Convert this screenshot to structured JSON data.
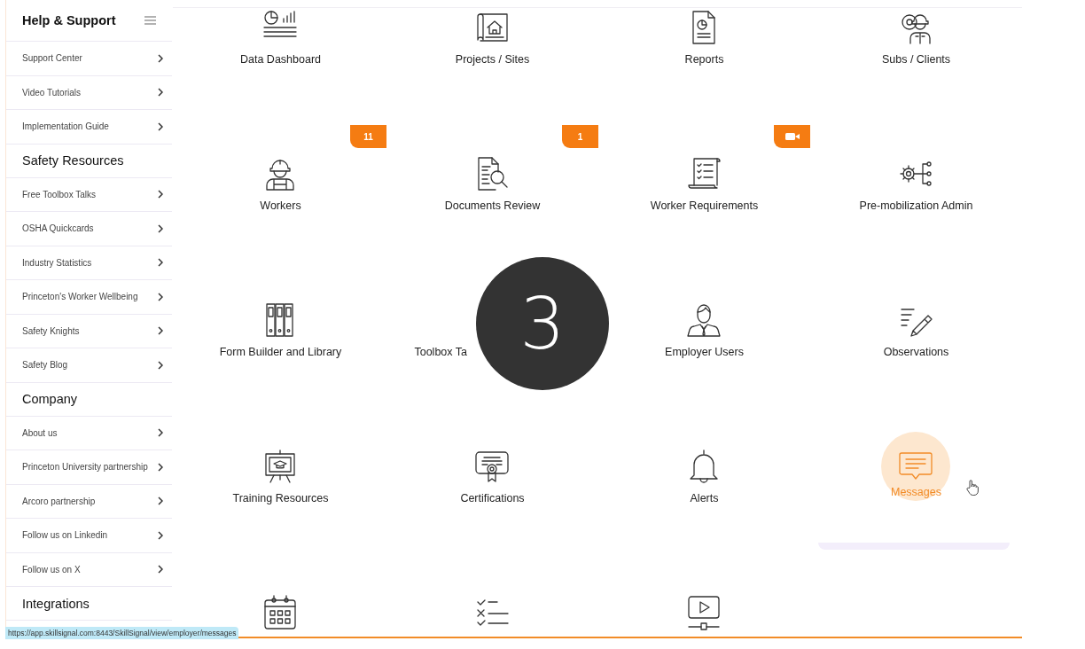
{
  "sidebar": {
    "sections": [
      {
        "title": "Help & Support",
        "menu_button": true,
        "items": [
          {
            "label": "Support Center"
          },
          {
            "label": "Video Tutorials"
          },
          {
            "label": "Implementation Guide"
          }
        ]
      },
      {
        "title": "Safety Resources",
        "menu_button": false,
        "items": [
          {
            "label": "Free Toolbox Talks"
          },
          {
            "label": "OSHA Quickcards"
          },
          {
            "label": "Industry Statistics"
          },
          {
            "label": "Princeton's Worker Wellbeing"
          },
          {
            "label": "Safety Knights"
          },
          {
            "label": "Safety Blog"
          }
        ]
      },
      {
        "title": "Company",
        "menu_button": false,
        "items": [
          {
            "label": "About us"
          },
          {
            "label": "Princeton University partnership"
          },
          {
            "label": "Arcoro partnership"
          },
          {
            "label": "Follow us on Linkedin"
          },
          {
            "label": "Follow us on X"
          }
        ]
      },
      {
        "title": "Integrations",
        "menu_button": false
      }
    ]
  },
  "tiles": [
    {
      "label": "Data Dashboard",
      "selected": false
    },
    {
      "label": "Projects / Sites",
      "selected": false
    },
    {
      "label": "Reports",
      "selected": false
    },
    {
      "label": "Subs / Clients",
      "selected": false
    },
    {
      "label": "Workers",
      "selected": false,
      "badge": {
        "kind": "count",
        "text": "11"
      }
    },
    {
      "label": "Documents Review",
      "selected": false,
      "badge": {
        "kind": "count",
        "text": "1"
      }
    },
    {
      "label": "Worker Requirements",
      "selected": false,
      "badge": {
        "kind": "video"
      }
    },
    {
      "label": "Pre-mobilization Admin",
      "selected": false
    },
    {
      "label": "Form Builder and Library",
      "selected": false
    },
    {
      "label": "Toolbox Ta",
      "selected": false,
      "covered": true
    },
    {
      "label": "Employer Users",
      "selected": false
    },
    {
      "label": "Observations",
      "selected": false
    },
    {
      "label": "Training Resources",
      "selected": false
    },
    {
      "label": "Certifications",
      "selected": false
    },
    {
      "label": "Alerts",
      "selected": false
    },
    {
      "label": "Messages",
      "selected": true
    },
    {
      "selected": false
    },
    {
      "selected": false
    },
    {
      "selected": false
    }
  ],
  "step_marker": "3",
  "status_url": "https://app.skillsignal.com:8443/SkillSignal/view/employer/messages"
}
